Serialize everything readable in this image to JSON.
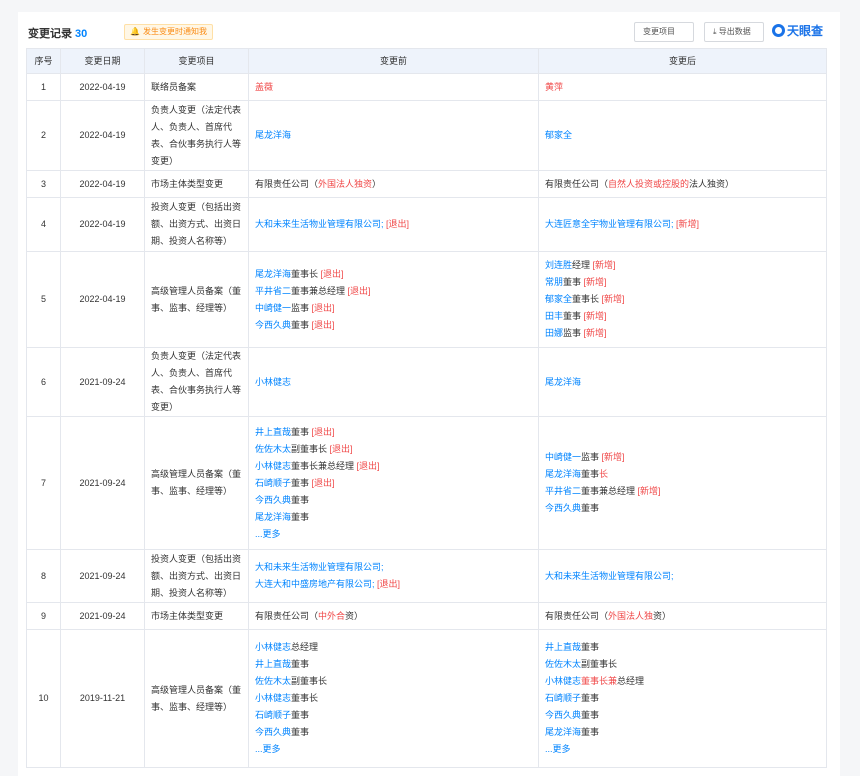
{
  "header": {
    "title": "变更记录",
    "count": "30",
    "notify_label": "发生变更时通知我",
    "filter_label": "变更项目",
    "export_label": "导出数据",
    "brand": "天眼查"
  },
  "columns": [
    "序号",
    "变更日期",
    "变更项目",
    "变更前",
    "变更后"
  ],
  "more_label": "...更多",
  "rows": [
    {
      "no": "1",
      "date": "2022-04-19",
      "item": "联络员备案",
      "before": [
        [
          {
            "t": "盖薇",
            "c": "red"
          }
        ]
      ],
      "after": [
        [
          {
            "t": "黄萍",
            "c": "red"
          }
        ]
      ]
    },
    {
      "no": "2",
      "date": "2022-04-19",
      "item": "负责人变更（法定代表人、负责人、首席代表、合伙事务执行人等变更）",
      "before": [
        [
          {
            "t": "尾龙洋海",
            "c": "blue"
          }
        ]
      ],
      "after": [
        [
          {
            "t": "郁家全",
            "c": "blue"
          }
        ]
      ]
    },
    {
      "no": "3",
      "date": "2022-04-19",
      "item": "市场主体类型变更",
      "before": [
        [
          {
            "t": "有限责任公司（",
            "c": ""
          },
          {
            "t": "外国法人独资",
            "c": "red"
          },
          {
            "t": "）",
            "c": ""
          }
        ]
      ],
      "after": [
        [
          {
            "t": "有限责任公司（",
            "c": ""
          },
          {
            "t": "自然人投资或控股的",
            "c": "red"
          },
          {
            "t": "法人独资）",
            "c": ""
          }
        ]
      ]
    },
    {
      "no": "4",
      "date": "2022-04-19",
      "item": "投资人变更（包括出资额、出资方式、出资日期、投资人名称等）",
      "before": [
        [
          {
            "t": "大和未来生活物业管理有限公司;",
            "c": "blue"
          },
          {
            "t": " [退出]",
            "c": "red"
          }
        ]
      ],
      "after": [
        [
          {
            "t": "大连匠意全宇物业管理有限公司;",
            "c": "blue"
          },
          {
            "t": " [新增]",
            "c": "red"
          }
        ]
      ]
    },
    {
      "no": "5",
      "date": "2022-04-19",
      "item": "高级管理人员备案（董事、监事、经理等）",
      "before": [
        [
          {
            "t": "尾龙洋海",
            "c": "blue"
          },
          {
            "t": "董事长",
            "c": ""
          },
          {
            "t": " [退出]",
            "c": "red"
          }
        ],
        [
          {
            "t": "平井省二",
            "c": "blue"
          },
          {
            "t": "董事兼总经理",
            "c": ""
          },
          {
            "t": " [退出]",
            "c": "red"
          }
        ],
        [
          {
            "t": "中崎健一",
            "c": "blue"
          },
          {
            "t": "监事",
            "c": ""
          },
          {
            "t": " [退出]",
            "c": "red"
          }
        ],
        [
          {
            "t": "今西久典",
            "c": "blue"
          },
          {
            "t": "董事",
            "c": ""
          },
          {
            "t": " [退出]",
            "c": "red"
          }
        ]
      ],
      "after": [
        [
          {
            "t": "刘连胜",
            "c": "blue"
          },
          {
            "t": "经理",
            "c": ""
          },
          {
            "t": " [新增]",
            "c": "red"
          }
        ],
        [
          {
            "t": "常朋",
            "c": "blue"
          },
          {
            "t": "董事",
            "c": ""
          },
          {
            "t": " [新增]",
            "c": "red"
          }
        ],
        [
          {
            "t": "郁家全",
            "c": "blue"
          },
          {
            "t": "董事长",
            "c": ""
          },
          {
            "t": " [新增]",
            "c": "red"
          }
        ],
        [
          {
            "t": "田丰",
            "c": "blue"
          },
          {
            "t": "董事",
            "c": ""
          },
          {
            "t": " [新增]",
            "c": "red"
          }
        ],
        [
          {
            "t": "田娜",
            "c": "blue"
          },
          {
            "t": "监事",
            "c": ""
          },
          {
            "t": " [新增]",
            "c": "red"
          }
        ]
      ]
    },
    {
      "no": "6",
      "date": "2021-09-24",
      "item": "负责人变更（法定代表人、负责人、首席代表、合伙事务执行人等变更）",
      "before": [
        [
          {
            "t": "小林健志",
            "c": "blue"
          }
        ]
      ],
      "after": [
        [
          {
            "t": "尾龙洋海",
            "c": "blue"
          }
        ]
      ]
    },
    {
      "no": "7",
      "date": "2021-09-24",
      "item": "高级管理人员备案（董事、监事、经理等）",
      "before": [
        [
          {
            "t": "井上直哉",
            "c": "blue"
          },
          {
            "t": "董事",
            "c": ""
          },
          {
            "t": " [退出]",
            "c": "red"
          }
        ],
        [
          {
            "t": "佐佐木太",
            "c": "blue"
          },
          {
            "t": "副董事长",
            "c": ""
          },
          {
            "t": " [退出]",
            "c": "red"
          }
        ],
        [
          {
            "t": "小林健志",
            "c": "blue"
          },
          {
            "t": "董事长兼总经理",
            "c": ""
          },
          {
            "t": " [退出]",
            "c": "red"
          }
        ],
        [
          {
            "t": "石崎顺子",
            "c": "blue"
          },
          {
            "t": "董事",
            "c": ""
          },
          {
            "t": " [退出]",
            "c": "red"
          }
        ],
        [
          {
            "t": "今西久典",
            "c": "blue"
          },
          {
            "t": "董事",
            "c": ""
          }
        ],
        [
          {
            "t": "尾龙洋海",
            "c": "blue"
          },
          {
            "t": "董事",
            "c": ""
          }
        ]
      ],
      "before_more": true,
      "after": [
        [
          {
            "t": "中崎健一",
            "c": "blue"
          },
          {
            "t": "监事",
            "c": ""
          },
          {
            "t": " [新增]",
            "c": "red"
          }
        ],
        [
          {
            "t": "尾龙洋海",
            "c": "blue"
          },
          {
            "t": "董事",
            "c": ""
          },
          {
            "t": "长",
            "c": "red"
          }
        ],
        [
          {
            "t": "平井省二",
            "c": "blue"
          },
          {
            "t": "董事兼总经理",
            "c": ""
          },
          {
            "t": " [新增]",
            "c": "red"
          }
        ],
        [
          {
            "t": "今西久典",
            "c": "blue"
          },
          {
            "t": "董事",
            "c": ""
          }
        ]
      ]
    },
    {
      "no": "8",
      "date": "2021-09-24",
      "item": "投资人变更（包括出资额、出资方式、出资日期、投资人名称等）",
      "before": [
        [
          {
            "t": "大和未来生活物业管理有限公司;",
            "c": "blue"
          }
        ],
        [
          {
            "t": "大连大和中盛房地产有限公司;",
            "c": "blue"
          },
          {
            "t": " [退出]",
            "c": "red"
          }
        ]
      ],
      "after": [
        [
          {
            "t": "大和未来生活物业管理有限公司;",
            "c": "blue"
          }
        ]
      ]
    },
    {
      "no": "9",
      "date": "2021-09-24",
      "item": "市场主体类型变更",
      "before": [
        [
          {
            "t": "有限责任公司（",
            "c": ""
          },
          {
            "t": "中外合",
            "c": "red"
          },
          {
            "t": "资）",
            "c": ""
          }
        ]
      ],
      "after": [
        [
          {
            "t": "有限责任公司（",
            "c": ""
          },
          {
            "t": "外国法人独",
            "c": "red"
          },
          {
            "t": "资）",
            "c": ""
          }
        ]
      ]
    },
    {
      "no": "10",
      "date": "2019-11-21",
      "item": "高级管理人员备案（董事、监事、经理等）",
      "before": [
        [
          {
            "t": "小林健志",
            "c": "blue"
          },
          {
            "t": "总经理",
            "c": ""
          }
        ],
        [
          {
            "t": "井上直哉",
            "c": "blue"
          },
          {
            "t": "董事",
            "c": ""
          }
        ],
        [
          {
            "t": "佐佐木太",
            "c": "blue"
          },
          {
            "t": "副董事长",
            "c": ""
          }
        ],
        [
          {
            "t": "小林健志",
            "c": "blue"
          },
          {
            "t": "董事长",
            "c": ""
          }
        ],
        [
          {
            "t": "石崎顺子",
            "c": "blue"
          },
          {
            "t": "董事",
            "c": ""
          }
        ],
        [
          {
            "t": "今西久典",
            "c": "blue"
          },
          {
            "t": "董事",
            "c": ""
          }
        ]
      ],
      "before_more": true,
      "after": [
        [
          {
            "t": "井上直哉",
            "c": "blue"
          },
          {
            "t": "董事",
            "c": ""
          }
        ],
        [
          {
            "t": "佐佐木太",
            "c": "blue"
          },
          {
            "t": "副董事长",
            "c": ""
          }
        ],
        [
          {
            "t": "小林健志",
            "c": "blue"
          },
          {
            "t": "董事长兼",
            "c": "red"
          },
          {
            "t": "总经理",
            "c": ""
          }
        ],
        [
          {
            "t": "石崎顺子",
            "c": "blue"
          },
          {
            "t": "董事",
            "c": ""
          }
        ],
        [
          {
            "t": "今西久典",
            "c": "blue"
          },
          {
            "t": "董事",
            "c": ""
          }
        ],
        [
          {
            "t": "尾龙洋海",
            "c": "blue"
          },
          {
            "t": "董事",
            "c": ""
          }
        ]
      ],
      "after_more": true
    }
  ]
}
